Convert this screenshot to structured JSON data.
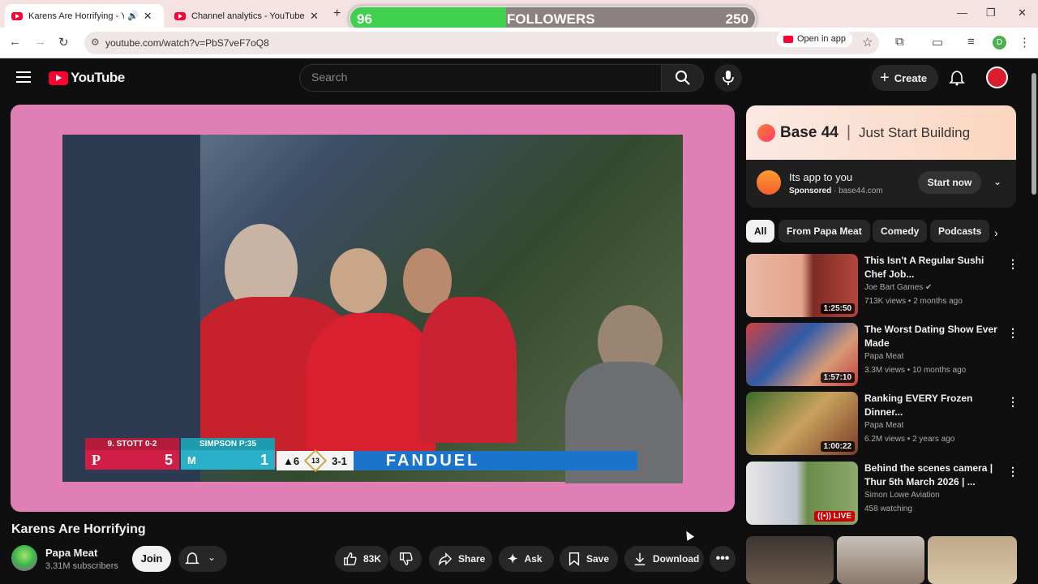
{
  "browser": {
    "tabs": [
      {
        "title": "Karens Are Horrifying - You",
        "active": true
      },
      {
        "title": "Channel analytics - YouTube St",
        "active": false
      }
    ],
    "url": "youtube.com/watch?v=PbS7veF7oQ8",
    "open_in_app": "Open in app",
    "profile_letter": "D"
  },
  "overlay": {
    "followers_current": "96",
    "followers_label": "FOLLOWERS",
    "followers_goal": "250",
    "progress_fraction": 0.384
  },
  "header": {
    "logo_text": "YouTube",
    "search_placeholder": "Search",
    "create_label": "Create"
  },
  "video": {
    "title": "Karens Are Horrifying",
    "channel": "Papa Meat",
    "subscribers": "3.31M subscribers",
    "join_label": "Join",
    "likes": "83K",
    "share_label": "Share",
    "ask_label": "Ask",
    "save_label": "Save",
    "download_label": "Download",
    "scorebug": {
      "away_label": "9. STOTT 0-2",
      "away_score": "5",
      "home_label": "SIMPSON P:35",
      "home_score": "1",
      "inning": "▲6",
      "pitch_count": "13",
      "count": "3-1",
      "sponsor": "FANDUEL"
    }
  },
  "ad": {
    "brand": "Base 44",
    "tagline": "Just Start Building",
    "title": "Its app to you",
    "sponsored": "Sponsored",
    "domain": "base44.com",
    "cta": "Start now"
  },
  "chips": [
    "All",
    "From Papa Meat",
    "Comedy",
    "Podcasts"
  ],
  "recommendations": [
    {
      "title": "This Isn't A Regular Sushi Chef Job...",
      "channel": "Joe Bart Games",
      "meta": "713K views • 2 months ago",
      "duration": "1:25:50",
      "verified": true
    },
    {
      "title": "The Worst Dating Show Ever Made",
      "channel": "Papa Meat",
      "meta": "3.3M views • 10 months ago",
      "duration": "1:57:10"
    },
    {
      "title": "Ranking EVERY Frozen Dinner...",
      "channel": "Papa Meat",
      "meta": "6.2M views • 2 years ago",
      "duration": "1:00:22"
    },
    {
      "title": "Behind the scenes camera | Thur 5th March 2026 | ...",
      "channel": "Simon Lowe Aviation",
      "meta": "458 watching",
      "live_label": "LIVE"
    }
  ],
  "colors": {
    "brand_red": "#ff0033",
    "page_bg": "#0f0f0f",
    "player_border": "#e07fb6",
    "progress_green": "#3fd14d"
  }
}
